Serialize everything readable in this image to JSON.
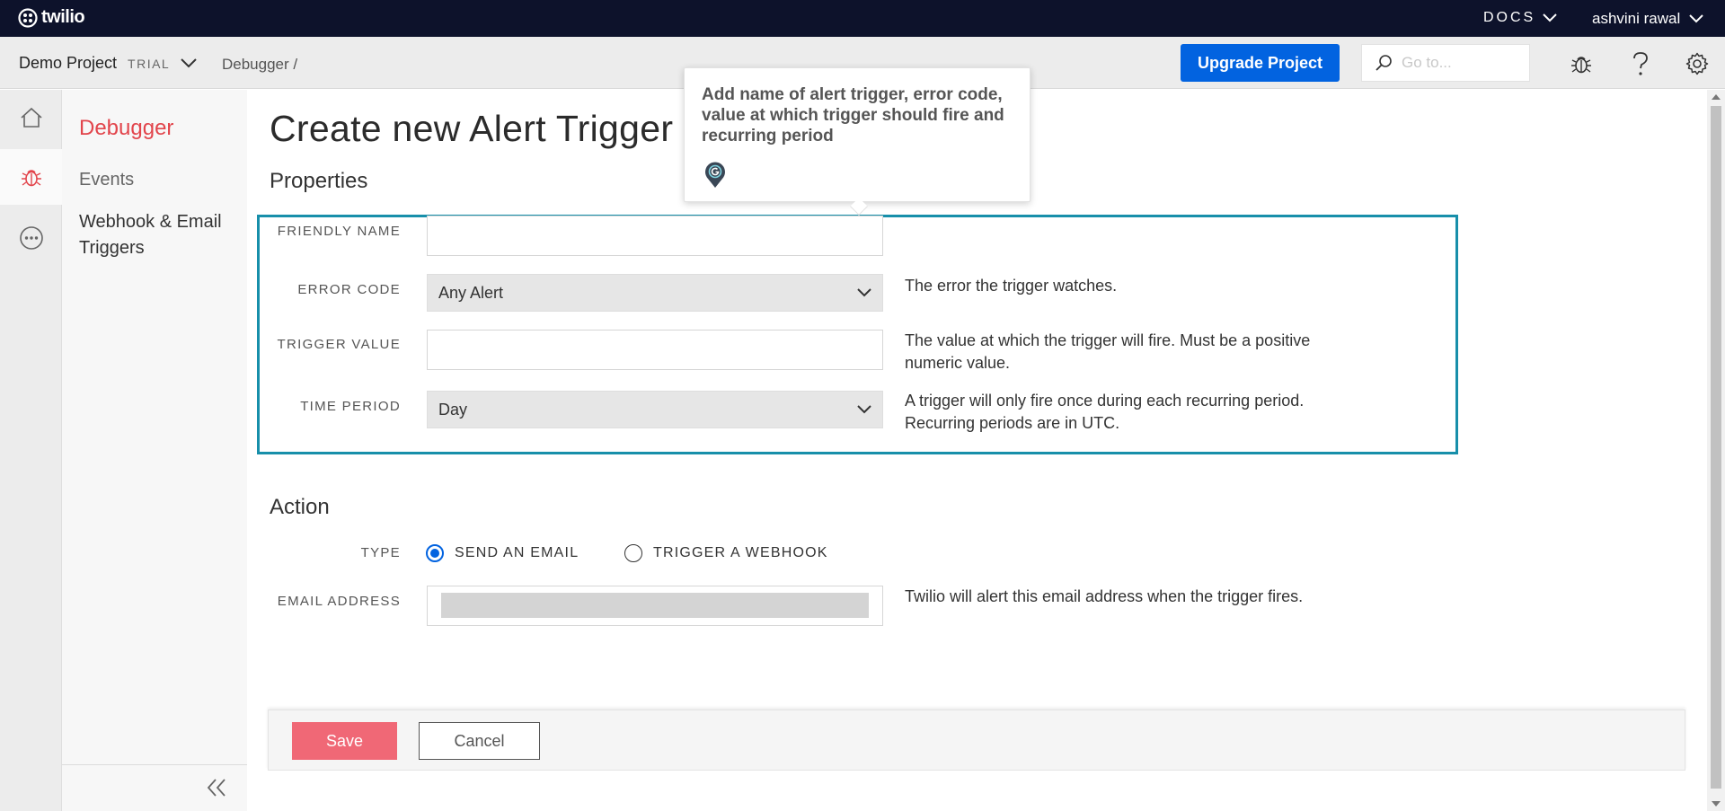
{
  "topbar": {
    "logo_text": "twilio",
    "docs_label": "DOCS",
    "user_name": "ashvini rawal"
  },
  "subbar": {
    "project_name": "Demo Project",
    "project_badge": "TRIAL",
    "breadcrumb": "Debugger  /",
    "upgrade_label": "Upgrade Project",
    "search_placeholder": "Go to..."
  },
  "rail": {
    "items": [
      "home-icon",
      "bug-icon",
      "more-icon"
    ]
  },
  "nav": {
    "title": "Debugger",
    "items": [
      {
        "label": "Events"
      },
      {
        "label": "Webhook & Email Triggers"
      }
    ]
  },
  "main": {
    "title": "Create new Alert Trigger",
    "properties": {
      "heading": "Properties",
      "friendly_name": {
        "label": "FRIENDLY NAME",
        "value": ""
      },
      "error_code": {
        "label": "ERROR CODE",
        "value": "Any Alert",
        "help": "The error the trigger watches."
      },
      "trigger_value": {
        "label": "TRIGGER VALUE",
        "value": "",
        "help": "The value at which the trigger will fire. Must be a positive numeric value."
      },
      "time_period": {
        "label": "TIME PERIOD",
        "value": "Day",
        "help": "A trigger will only fire once during each recurring period. Recurring periods are in UTC."
      }
    },
    "action": {
      "heading": "Action",
      "type_label": "TYPE",
      "options": [
        {
          "label": "SEND AN EMAIL",
          "checked": true
        },
        {
          "label": "TRIGGER A WEBHOOK",
          "checked": false
        }
      ],
      "email_label": "EMAIL ADDRESS",
      "email_help": "Twilio will alert this email address when the trigger fires."
    },
    "buttons": {
      "save": "Save",
      "cancel": "Cancel"
    }
  },
  "tooltip": {
    "text": "Add name of alert trigger, error code, value at which trigger should fire and recurring period"
  },
  "colors": {
    "topbar_bg": "#0d122b",
    "accent_blue": "#0263e0",
    "nav_title_red": "#e2454c",
    "highlight_box": "#178faa",
    "save_button": "#f06876"
  }
}
